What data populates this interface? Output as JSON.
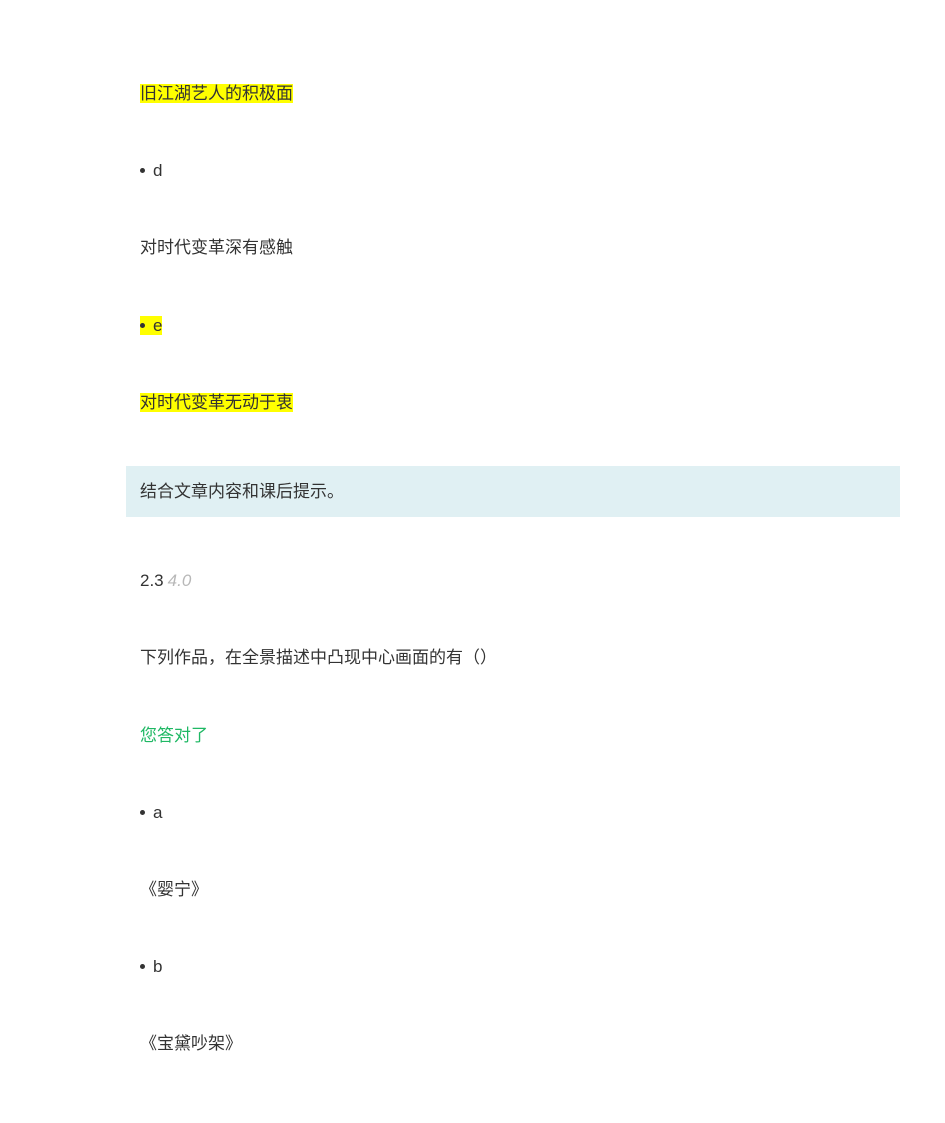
{
  "q1_option_c_text": "旧江湖艺人的积极面",
  "q1_option_d_label": "d",
  "q1_option_d_text": "对时代变革深有感触",
  "q1_option_e_label": "e",
  "q1_option_e_text": "对时代变革无动于衷",
  "q1_feedback": "结合文章内容和课后提示。",
  "q2_number": "2.3",
  "q2_max": "4.0",
  "q2_prompt": "下列作品，在全景描述中凸现中心画面的有（）",
  "q2_correct_msg": "您答对了",
  "q2_option_a_label": "a",
  "q2_option_a_text": "《婴宁》",
  "q2_option_b_label": "b",
  "q2_option_b_text": "《宝黛吵架》"
}
